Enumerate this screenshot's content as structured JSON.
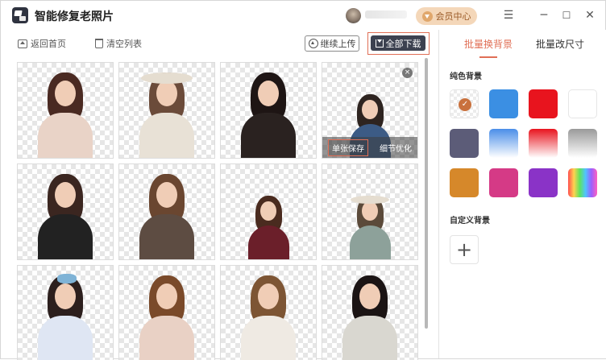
{
  "app": {
    "title": "智能修复老照片"
  },
  "header": {
    "vip_label": "会员中心",
    "minimize": "─",
    "maximize": "☐",
    "close": "✕",
    "menu": "☰"
  },
  "toolbar": {
    "back_label": "返回首页",
    "clear_label": "清空列表",
    "continue_upload_label": "继续上传",
    "download_all_label": "全部下载"
  },
  "card_actions": {
    "save_single": "单张保存",
    "detail_optimize": "细节优化",
    "close": "×"
  },
  "images": [
    {
      "id": 1,
      "hair": "#4a2a22",
      "top": "#e9d3c7"
    },
    {
      "id": 2,
      "hair": "#6b4b3a",
      "top": "#e8e1d6",
      "hat": true
    },
    {
      "id": 3,
      "hair": "#1e1514",
      "top": "#2a2220"
    },
    {
      "id": 4,
      "hair": "#2e2420",
      "top": "#3c5b85",
      "small": true
    },
    {
      "id": 5,
      "hair": "#3b2620",
      "top": "#222"
    },
    {
      "id": 6,
      "hair": "#6a4630",
      "top": "#5d4c42"
    },
    {
      "id": 7,
      "hair": "#4a2b1f",
      "top": "#6b1f2a",
      "small": true
    },
    {
      "id": 8,
      "hair": "#5b4a3a",
      "top": "#8da19a",
      "hat": true,
      "small": true
    },
    {
      "id": 9,
      "hair": "#2c1f1d",
      "top": "#dfe6f3",
      "bow": true
    },
    {
      "id": 10,
      "hair": "#7a4a2a",
      "top": "#e9d1c5"
    },
    {
      "id": 11,
      "hair": "#7d5534",
      "top": "#efeae3"
    },
    {
      "id": 12,
      "hair": "#1b1414",
      "top": "#d9d7d0"
    }
  ],
  "panel": {
    "tab_bg": "批量换背景",
    "tab_size": "批量改尺寸",
    "solid_title": "纯色背景",
    "custom_title": "自定义背景",
    "add_label": "+",
    "check": "✓",
    "colors": [
      {
        "name": "transparent",
        "fill": "checker",
        "selected": true
      },
      {
        "name": "blue",
        "fill": "#3b8fe3"
      },
      {
        "name": "red",
        "fill": "#e8141e"
      },
      {
        "name": "white",
        "fill": "#ffffff"
      },
      {
        "name": "slate",
        "fill": "#5c5c78"
      },
      {
        "name": "blue-gradient",
        "fill": "linear-gradient(#4a8ee8,#ffffff)"
      },
      {
        "name": "red-gradient",
        "fill": "linear-gradient(#e8141e,#ffffff)"
      },
      {
        "name": "gray-gradient",
        "fill": "linear-gradient(#9a9a9a,#ffffff)"
      },
      {
        "name": "orange",
        "fill": "#d6882a"
      },
      {
        "name": "pink",
        "fill": "#d53a86"
      },
      {
        "name": "purple",
        "fill": "#8a33c7"
      },
      {
        "name": "rainbow",
        "fill": "linear-gradient(90deg,#ff4f4f,#ffd34f,#5fe35f,#4fc4ff,#9b5fff,#ff5fbf)"
      }
    ]
  }
}
